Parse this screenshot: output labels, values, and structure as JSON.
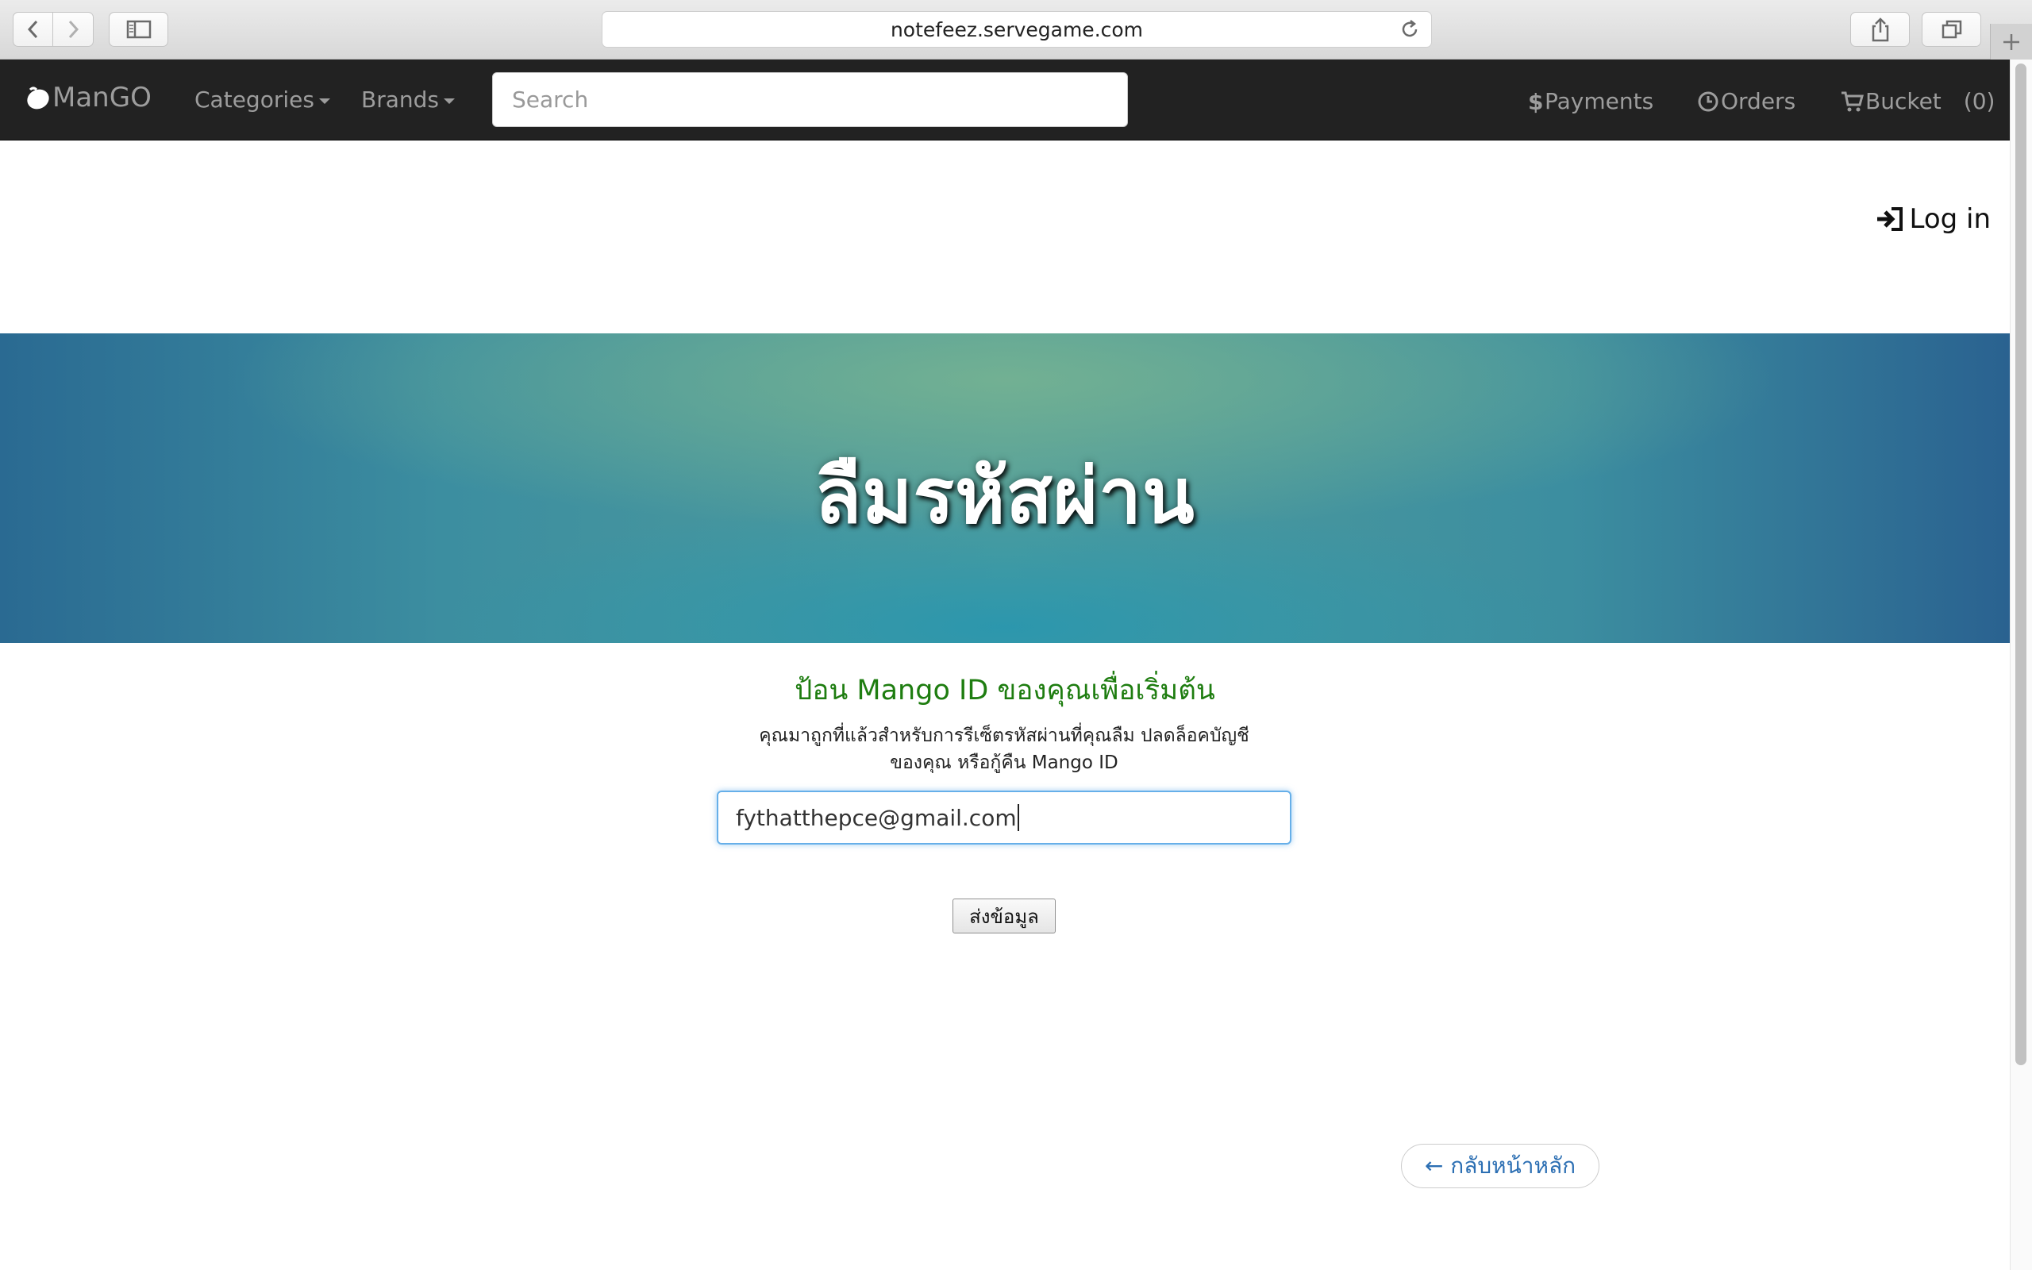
{
  "browser": {
    "url": "notefeez.servegame.com"
  },
  "navbar": {
    "brand": "ManGO",
    "categories_label": "Categories",
    "brands_label": "Brands",
    "search_placeholder": "Search",
    "payments_label": "Payments",
    "orders_label": "Orders",
    "bucket_label": "Bucket",
    "bucket_count": "(0)"
  },
  "login_label": "Log in",
  "hero": {
    "title": "ลืมรหัสผ่าน"
  },
  "form": {
    "title": "ป้อน Mango ID ของคุณเพื่อเริ่มต้น",
    "description_line1": "คุณมาถูกที่แล้วสำหรับการรีเซ็ตรหัสผ่านที่คุณลืม ปลดล็อคบัญชี",
    "description_line2": "ของคุณ หรือกู้คืน Mango ID",
    "email_value": "fythatthepce@gmail.com",
    "submit_label": "ส่งข้อมูล"
  },
  "back_link": "← กลับหน้าหลัก",
  "colors": {
    "navbar_bg": "#222222",
    "form_title": "#1e7d10",
    "link": "#2c6fb3",
    "focus_ring": "#66afe9"
  }
}
